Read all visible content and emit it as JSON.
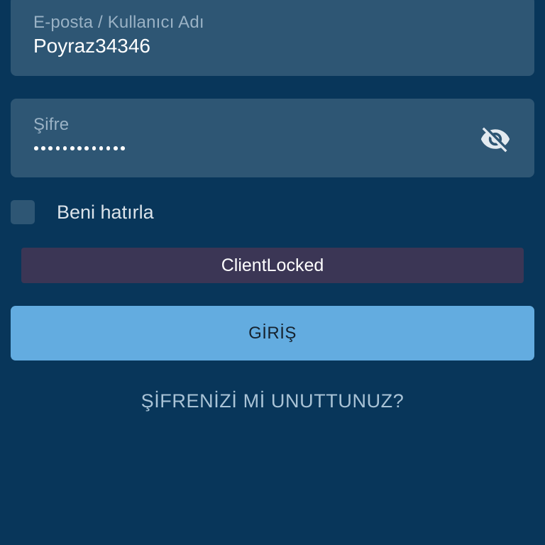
{
  "login_form": {
    "username": {
      "label": "E-posta / Kullanıcı Adı",
      "value": "Poyraz34346"
    },
    "password": {
      "label": "Şifre",
      "masked_length": 13,
      "toggle_icon": "eye-off-icon"
    },
    "remember_me": {
      "label": "Beni hatırla",
      "checked": false
    },
    "error_message": "ClientLocked",
    "submit_label": "GİRİŞ",
    "forgot_password_label": "ŞİFRENİZİ Mİ UNUTTUNUZ?"
  },
  "colors": {
    "background": "#08365a",
    "field_background": "#2e5674",
    "error_background": "#3b3655",
    "button_background": "#63ace0"
  }
}
